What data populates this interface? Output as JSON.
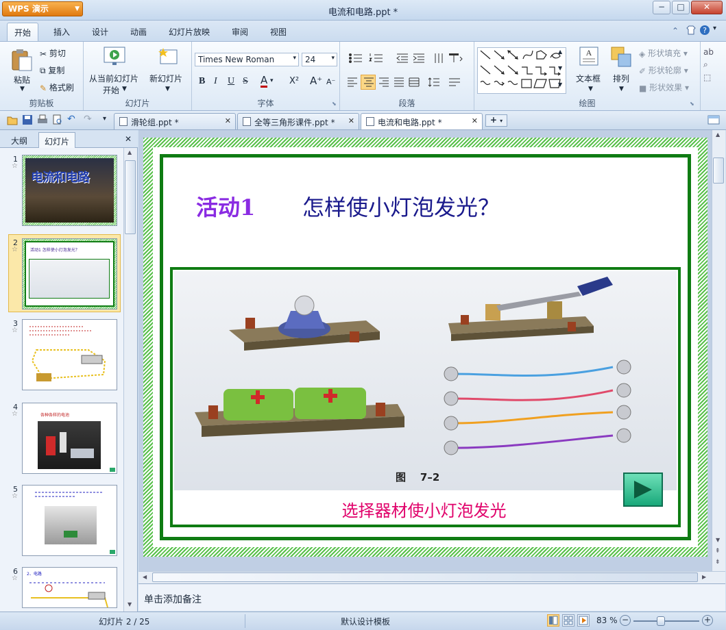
{
  "app": {
    "name": "WPS 演示",
    "window_title": "电流和电路.ppt *"
  },
  "menu": {
    "items": [
      "开始",
      "插入",
      "设计",
      "动画",
      "幻灯片放映",
      "审阅",
      "视图"
    ],
    "active": "开始"
  },
  "ribbon": {
    "clipboard": {
      "paste": "粘贴",
      "cut": "剪切",
      "copy": "复制",
      "format_painter": "格式刷",
      "label": "剪贴板"
    },
    "slides": {
      "from_current": "从当前幻灯片",
      "start": "开始",
      "new_slide": "新幻灯片",
      "label": "幻灯片"
    },
    "font": {
      "name": "Times New Roman",
      "size": "24",
      "label": "字体"
    },
    "paragraph": {
      "label": "段落"
    },
    "drawing": {
      "textbox": "文本框",
      "arrange": "排列",
      "shape_fill": "形状填充",
      "shape_outline": "形状轮廓",
      "shape_effect": "形状效果",
      "label": "绘图"
    }
  },
  "doc_tabs": [
    {
      "label": "滑轮组.ppt *",
      "active": false
    },
    {
      "label": "全等三角形课件.ppt *",
      "active": false
    },
    {
      "label": "电流和电路.ppt *",
      "active": true
    }
  ],
  "side_panel": {
    "tabs": [
      "大纲",
      "幻灯片"
    ],
    "active": "幻灯片"
  },
  "thumbnails": [
    {
      "num": "1",
      "text": "电流和电路"
    },
    {
      "num": "2",
      "text": "活动1 怎样使小灯泡发光？"
    },
    {
      "num": "3",
      "text": ""
    },
    {
      "num": "4",
      "text": "各种各样的电池"
    },
    {
      "num": "5",
      "text": ""
    },
    {
      "num": "6",
      "text": "2、电路"
    }
  ],
  "slide": {
    "title_activity": "活动1",
    "title_question": "怎样使小灯泡发光？",
    "figure_label": "图    7–2",
    "caption": "选择器材使小灯泡发光"
  },
  "notes": {
    "placeholder": "单击添加备注"
  },
  "status": {
    "slide_info": "幻灯片 2 / 25",
    "template": "默认设计模板",
    "zoom": "83 %"
  },
  "colors": {
    "slide_green": "#0f7c13",
    "activity": "#8a2be2",
    "question": "#1a1a8c",
    "caption": "#e0006a"
  }
}
